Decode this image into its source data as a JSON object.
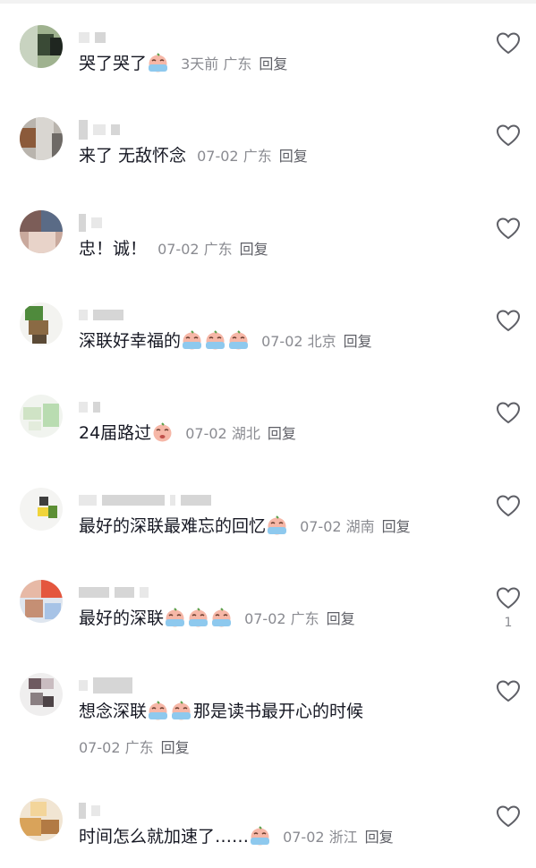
{
  "comments": [
    {
      "text": "哭了哭了",
      "emojis": 1,
      "date": "3天前",
      "location": "广东",
      "reply": "回复",
      "likes": ""
    },
    {
      "text": "来了 无敌怀念",
      "emojis": 0,
      "date": "07-02",
      "location": "广东",
      "reply": "回复",
      "likes": ""
    },
    {
      "text": "忠！诚！",
      "emojis": 0,
      "date": "07-02",
      "location": "广东",
      "reply": "回复",
      "likes": ""
    },
    {
      "text": "深联好幸福的",
      "emojis": 3,
      "date": "07-02",
      "location": "北京",
      "reply": "回复",
      "likes": ""
    },
    {
      "text": "24届路过",
      "emojis": 1,
      "date": "07-02",
      "location": "湖北",
      "reply": "回复",
      "likes": ""
    },
    {
      "text": "最好的深联最难忘的回忆",
      "emojis": 1,
      "date": "07-02",
      "location": "湖南",
      "reply": "回复",
      "likes": ""
    },
    {
      "text": "最好的深联",
      "emojis": 3,
      "date": "07-02",
      "location": "广东",
      "reply": "回复",
      "likes": "1"
    },
    {
      "text": "想念深联",
      "text_after": "那是读书最开心的时候",
      "emojis": 2,
      "date": "07-02",
      "location": "广东",
      "reply": "回复",
      "likes": ""
    },
    {
      "text": "时间怎么就加速了……",
      "emojis": 1,
      "date": "07-02",
      "location": "浙江",
      "reply": "回复",
      "likes": ""
    }
  ],
  "icons": {
    "like": "heart-outline-icon",
    "emoji": "crying-face-emoji"
  },
  "colors": {
    "text": "#161823",
    "meta": "#8a8b91",
    "reply": "#5e5f66"
  }
}
